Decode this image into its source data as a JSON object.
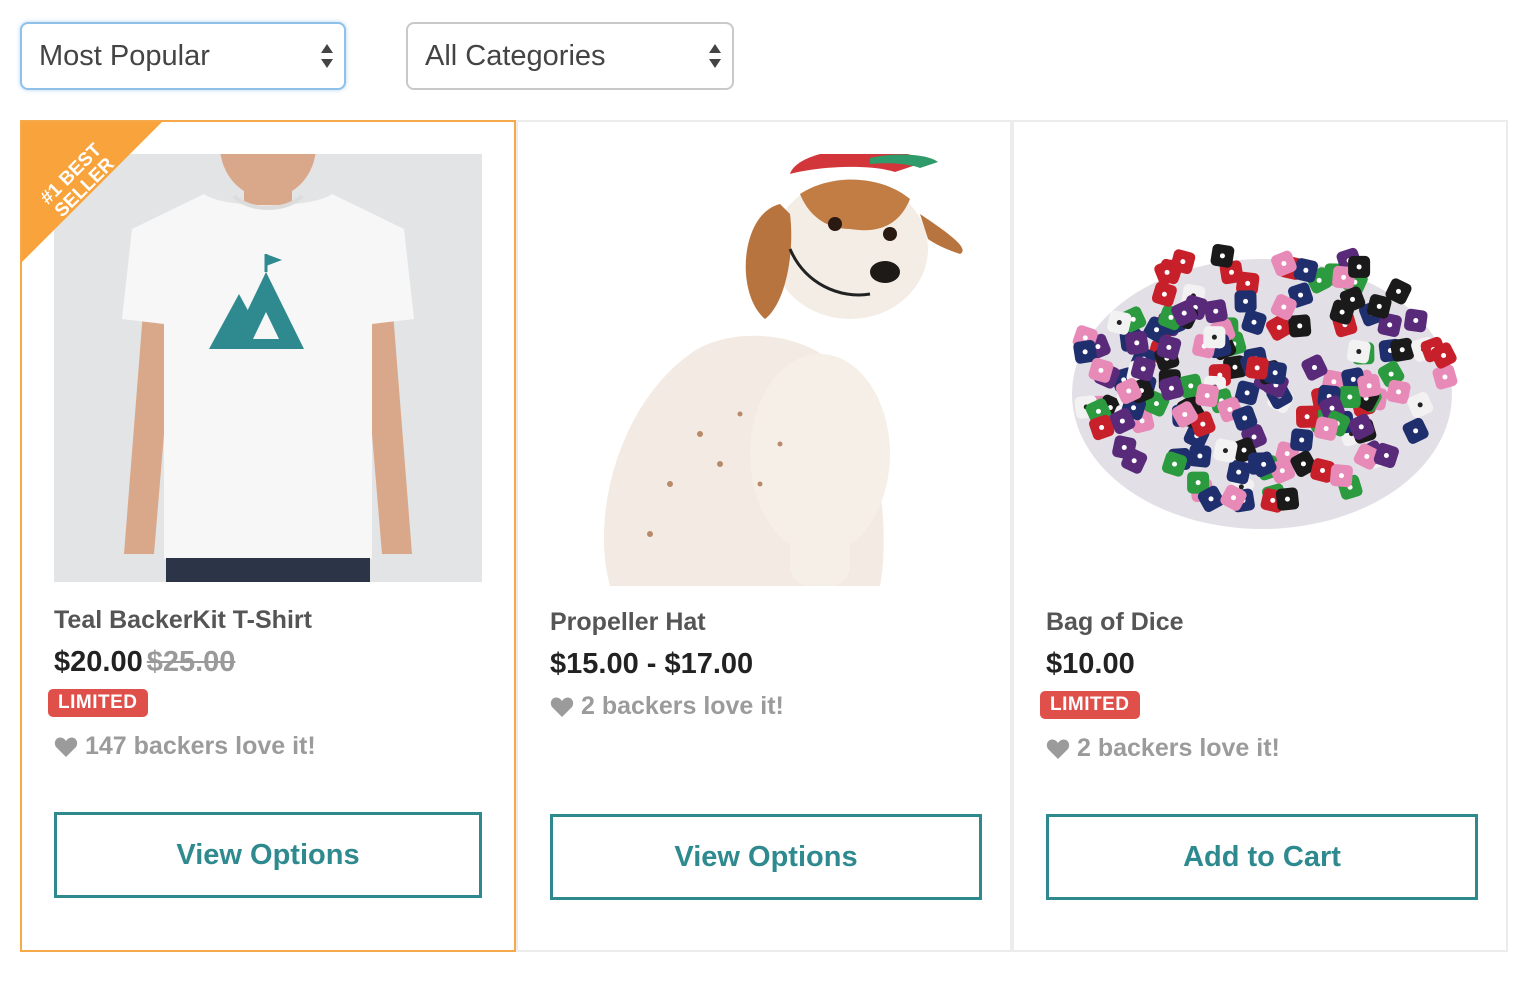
{
  "filters": {
    "sort": {
      "selected": "Most Popular"
    },
    "category": {
      "selected": "All Categories"
    }
  },
  "products": [
    {
      "ribbon": "#1 BEST SELLER",
      "title": "Teal BackerKit T-Shirt",
      "price": "$20.00",
      "old_price": "$25.00",
      "badge": "LIMITED",
      "love": "147 backers love it!",
      "button": "View Options",
      "image": "white-tshirt-teal-mountain-logo"
    },
    {
      "title": "Propeller Hat",
      "price": "$15.00 - $17.00",
      "love": "2 backers love it!",
      "button": "View Options",
      "image": "dog-wearing-cap"
    },
    {
      "title": "Bag of Dice",
      "price": "$10.00",
      "badge": "LIMITED",
      "love": "2 backers love it!",
      "button": "Add to Cart",
      "image": "pile-of-colored-dice"
    }
  ],
  "colors": {
    "accent": "#2f8a8f",
    "ribbon": "#f8a33b",
    "badge": "#e0504a",
    "featured_border": "#f6a94b"
  }
}
